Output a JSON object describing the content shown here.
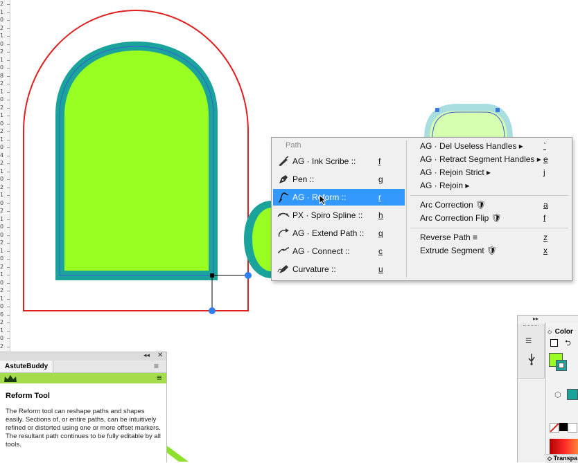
{
  "ruler": {
    "ticks": [
      "2",
      "1",
      "0",
      "2",
      "1",
      "0",
      "2",
      "1",
      "0",
      "8",
      "2",
      "1",
      "0",
      "2",
      "1",
      "0",
      "2",
      "1",
      "0",
      "4",
      "2",
      "1",
      "0",
      "2",
      "1",
      "0",
      "2",
      "1",
      "0",
      "0",
      "2",
      "1",
      "0",
      "2",
      "1",
      "0",
      "2",
      "1",
      "0",
      "6",
      "2",
      "1",
      "0",
      "2",
      "1",
      "0",
      "8",
      "2",
      "1",
      "0",
      "2",
      "1",
      "0",
      "2",
      "1",
      "0",
      "2",
      "1"
    ]
  },
  "menu": {
    "header": "Path",
    "left_items": [
      {
        "label": "AG · Ink Scribe ::",
        "key": "f",
        "icon": "ink-scribe-icon"
      },
      {
        "label": "Pen ::",
        "key": "g",
        "icon": "pen-icon"
      },
      {
        "label": "AG · Reform ::",
        "key": "r",
        "icon": "reform-icon",
        "selected": true
      },
      {
        "label": "PX · Spiro Spline ::",
        "key": "h",
        "icon": "spiro-spline-icon"
      },
      {
        "label": "AG · Extend Path ::",
        "key": "q",
        "icon": "extend-path-icon"
      },
      {
        "label": "AG · Connect ::",
        "key": "c",
        "icon": "connect-icon"
      },
      {
        "label": "Curvature ::",
        "key": "u",
        "icon": "curvature-icon"
      }
    ],
    "right_group1": [
      {
        "label": "AG · Del Useless Handles ▸",
        "key": "`"
      },
      {
        "label": "AG · Retract Segment Handles ▸",
        "key": "e"
      },
      {
        "label": "AG · Rejoin Strict ▸",
        "key": "j"
      },
      {
        "label": "AG · Rejoin ▸",
        "key": ""
      }
    ],
    "right_group2": [
      {
        "label": "Arc Correction 🛡",
        "key": "a"
      },
      {
        "label": "Arc Correction Flip 🛡",
        "key": "f"
      }
    ],
    "right_group3": [
      {
        "label": "Reverse Path ≡",
        "key": "z"
      },
      {
        "label": "Extrude Segment 🛡",
        "key": "x"
      }
    ]
  },
  "buddy": {
    "tab": "AstuteBuddy",
    "title": "Reform Tool",
    "description": "The Reform tool can reshape paths and shapes easily. Sections of, or entire paths, can be intuitively refined or distorted using one or more offset markers. The resultant path continues to be fully editable by all tools."
  },
  "rpanel": {
    "color_label": "Color",
    "transparency_label": "Transpa"
  },
  "colors": {
    "fill": "#99ff22",
    "stroke": "#1aa39a",
    "offset": "#e01f1f",
    "selection": "#3399ff"
  }
}
